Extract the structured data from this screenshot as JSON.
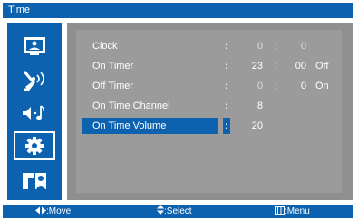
{
  "title": "Time",
  "sidebar": {
    "items": [
      {
        "icon": "picture-icon"
      },
      {
        "icon": "antenna-icon"
      },
      {
        "icon": "sound-icon"
      },
      {
        "icon": "gear-icon",
        "active": true
      },
      {
        "icon": "input-source-icon"
      }
    ]
  },
  "menu": {
    "rows": [
      {
        "label": "Clock",
        "v1": "0",
        "sep": ":",
        "v2": "0",
        "v3": ""
      },
      {
        "label": "On Timer",
        "v1": "23",
        "sep": ":",
        "v2": "00",
        "v3": "Off"
      },
      {
        "label": "Off Timer",
        "v1": "0",
        "sep": ":",
        "v2": "0",
        "v3": "On"
      },
      {
        "label": "On Time Channel",
        "v1": "8",
        "sep": "",
        "v2": "",
        "v3": ""
      },
      {
        "label": "On Time Volume",
        "v1": "20",
        "sep": "",
        "v2": "",
        "v3": "",
        "selected": true
      }
    ],
    "colon": ":"
  },
  "footer": {
    "move": ":Move",
    "select": ":Select",
    "menu": ":Menu"
  },
  "colors": {
    "accent": "#0d62b0",
    "panel": "#9b9b9b"
  }
}
